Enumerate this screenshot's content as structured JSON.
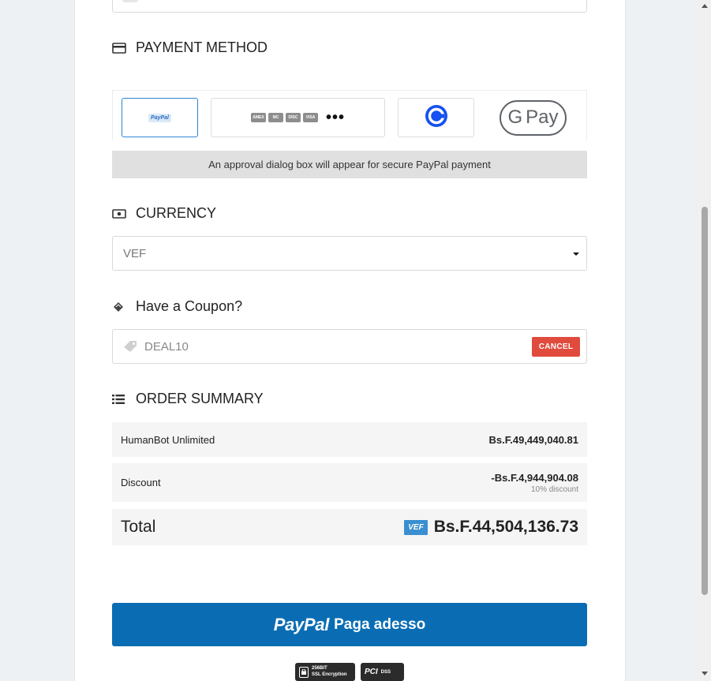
{
  "payment_method": {
    "heading": "PAYMENT METHOD",
    "options": {
      "paypal_logo_text": "PayPal",
      "card_logos": [
        "AMEX",
        "MC",
        "DISC",
        "VISA"
      ],
      "more_label": "•••",
      "gpay_g": "G",
      "gpay_pay": "Pay"
    },
    "approval_notice": "An approval dialog box will appear for secure PayPal payment",
    "selected": "paypal"
  },
  "currency": {
    "heading": "CURRENCY",
    "selected_value": "VEF"
  },
  "coupon": {
    "heading": "Have a Coupon?",
    "code": "DEAL10",
    "cancel_label": "CANCEL"
  },
  "order_summary": {
    "heading": "ORDER SUMMARY",
    "item": {
      "name": "HumanBot Unlimited",
      "amount": "Bs.F.49,449,040.81"
    },
    "discount": {
      "label": "Discount",
      "amount": "-Bs.F.4,944,904.08",
      "note": "10% discount"
    },
    "total": {
      "label": "Total",
      "currency_badge": "VEF",
      "amount": "Bs.F.44,504,136.73"
    }
  },
  "pay_button": {
    "brand": "PayPal",
    "label": "Paga adesso"
  },
  "security_badges": {
    "ssl_line1": "256BIT",
    "ssl_line2": "SSL Encryption",
    "pci_text": "PCI",
    "pci_sub": "DSS"
  },
  "colors": {
    "accent": "#0a6db4",
    "cancel_red": "#e04b3d",
    "vef_badge": "#3a8fd0",
    "selected_border": "#2f86d4"
  }
}
